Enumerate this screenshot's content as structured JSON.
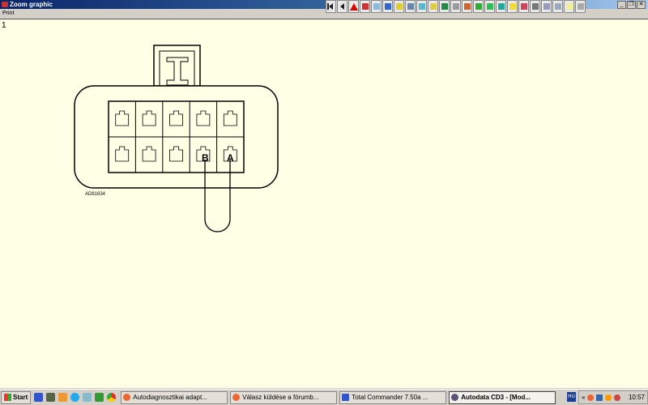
{
  "window": {
    "title": "Zoom graphic",
    "menu": [
      "Print"
    ]
  },
  "toolbar": {
    "icons": [
      "first-icon",
      "previous-icon",
      "warning-icon",
      "tool1-icon",
      "tool2-icon",
      "tool3-icon",
      "tool4-icon",
      "tool5-icon",
      "tool6-icon",
      "tool7-icon",
      "tool8-icon",
      "tool9-icon",
      "tool10-icon",
      "tool11-icon",
      "tool12-icon",
      "tool13-icon",
      "tool14-icon",
      "tool15-icon",
      "tool16-icon",
      "tool17-icon",
      "tool18-icon",
      "tool19-icon",
      "tool20-icon"
    ],
    "colors": [
      "#333",
      "#333",
      "#d00",
      "#c33",
      "#8bd",
      "#36c",
      "#dc3",
      "#68a",
      "#5bc",
      "#dc4",
      "#284",
      "#999",
      "#c63",
      "#3a3",
      "#3b5",
      "#2a9",
      "#ed3",
      "#c45",
      "#777",
      "#99b",
      "#9ab",
      "#ee9"
    ]
  },
  "canvas": {
    "page_number": "1",
    "diagram_ref": "AD81634",
    "pin_labels": [
      "B",
      "A"
    ]
  },
  "taskbar": {
    "start": "Start",
    "tasks": [
      "Autodiagnosztikai adapt...",
      "Válasz küldése a fórumb...",
      "Total Commander 7.50a ...",
      "Autodata CD3 - [Mod..."
    ],
    "language": "HU",
    "clock": "10:57"
  }
}
